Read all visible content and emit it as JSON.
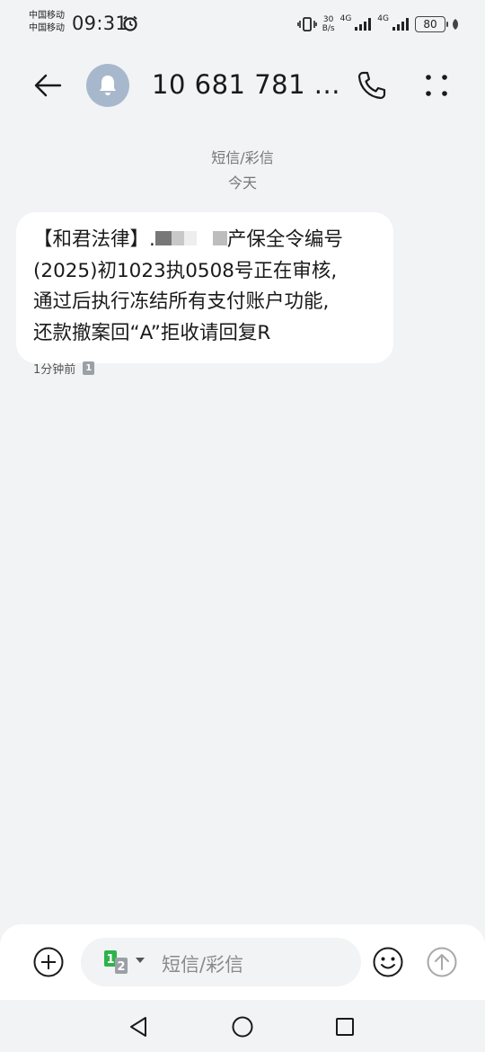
{
  "status_bar": {
    "carrier_1": "中国移动",
    "carrier_2": "中国移动",
    "time": "09:31",
    "net_speed_value": "30",
    "net_speed_unit": "B/s",
    "sim1_network": "4G",
    "sim2_network": "4G",
    "battery": "80"
  },
  "header": {
    "contact_name": "10 681 781 ...",
    "avatar_icon": "bell-icon",
    "back_icon": "arrow-left-icon",
    "call_icon": "phone-icon",
    "more_icon": "more-vertical-icon"
  },
  "conversation": {
    "channel_label": "短信/彩信",
    "date_label": "今天",
    "message": {
      "line1_prefix": "【和君法律】.",
      "line1_suffix": "产保全令编号",
      "line2": "(2025)初1023执0508号正在审核,",
      "line3": "通过后执行冻结所有支付账户功能,",
      "line4": "还款撤案回“A”拒收请回复R"
    },
    "message_time": "1分钟前",
    "message_sim": "1"
  },
  "composer": {
    "placeholder": "短信/彩信",
    "sim_primary": "1",
    "sim_secondary": "2",
    "add_icon": "add-circle-icon",
    "emoji_icon": "emoji-icon",
    "send_icon": "send-arrow-up-icon"
  },
  "nav": {
    "back_icon": "triangle-back-icon",
    "home_icon": "circle-home-icon",
    "recent_icon": "square-recents-icon"
  }
}
